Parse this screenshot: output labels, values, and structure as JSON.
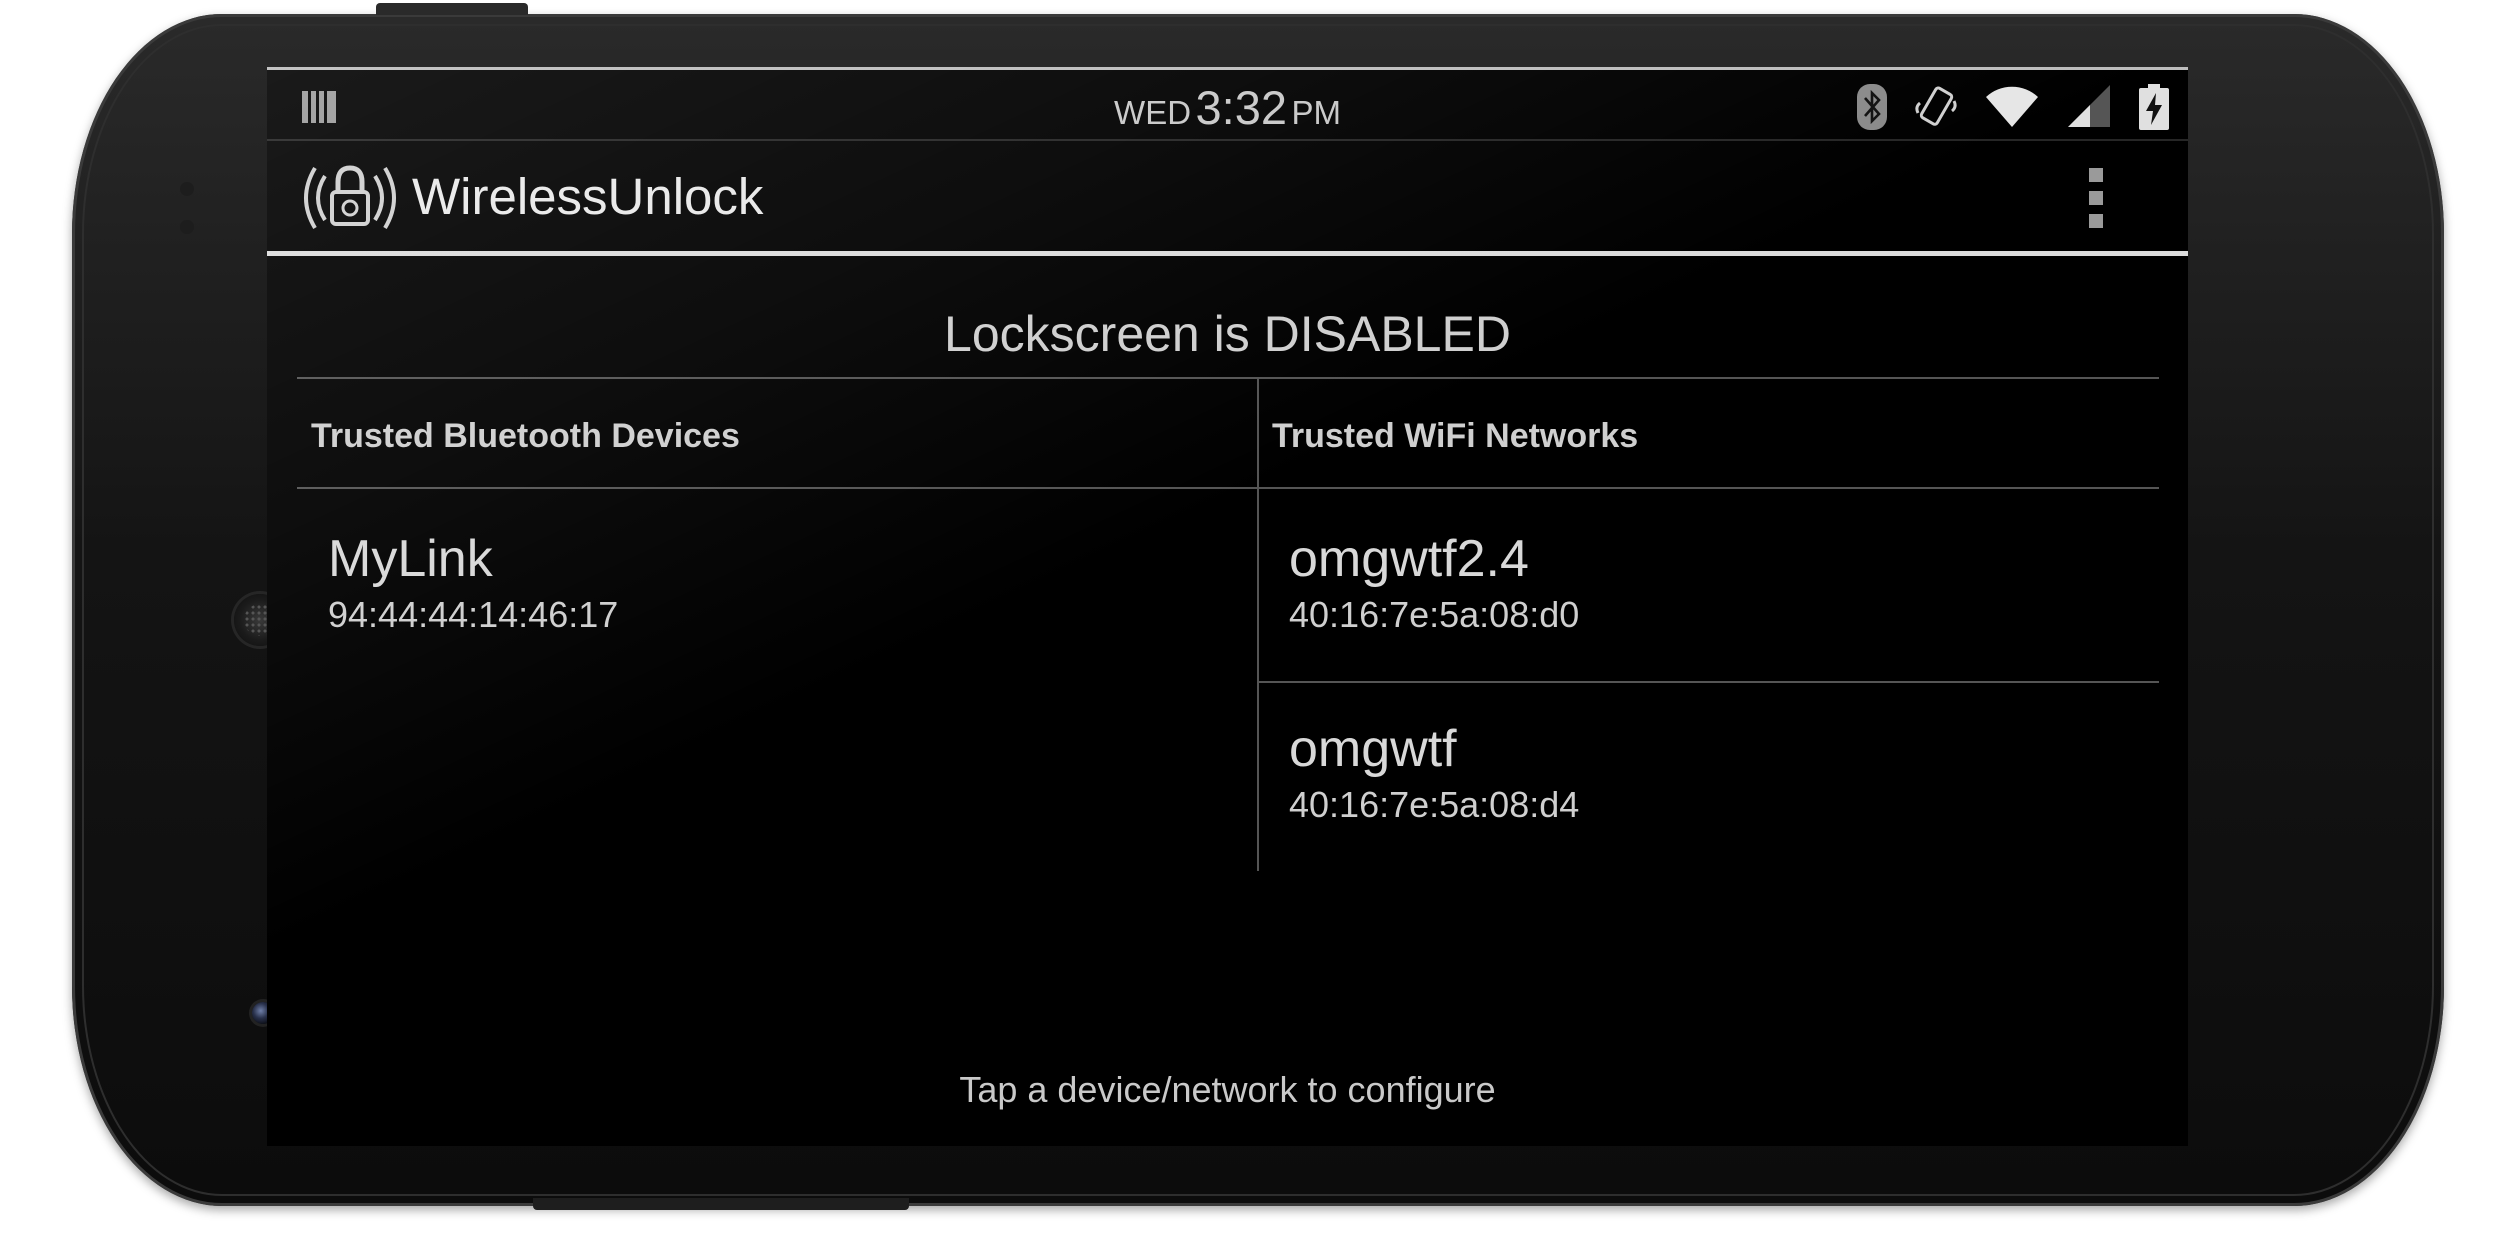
{
  "status_bar": {
    "day": "WED",
    "time": "3:32",
    "ampm": "PM",
    "icons": [
      "notification-icon",
      "bluetooth-icon",
      "vibrate-icon",
      "wifi-icon",
      "cell-signal-icon",
      "battery-charging-icon"
    ]
  },
  "action_bar": {
    "app_title": "WirelessUnlock",
    "logo_icon": "wireless-lock-icon",
    "overflow_icon": "overflow-menu-icon"
  },
  "main": {
    "lock_status": "Lockscreen is DISABLED",
    "bluetooth": {
      "header": "Trusted Bluetooth Devices",
      "items": [
        {
          "name": "MyLink",
          "address": "94:44:44:14:46:17"
        }
      ]
    },
    "wifi": {
      "header": "Trusted WiFi Networks",
      "items": [
        {
          "name": "omgwtf2.4",
          "address": "40:16:7e:5a:08:d0"
        },
        {
          "name": "omgwtf",
          "address": "40:16:7e:5a:08:d4"
        }
      ]
    },
    "footer_hint": "Tap a device/network to configure"
  },
  "colors": {
    "screen_bg": "#000000",
    "text_primary": "#d8d8d8",
    "divider": "#555555",
    "actionbar_underline": "#dcdcdc"
  }
}
